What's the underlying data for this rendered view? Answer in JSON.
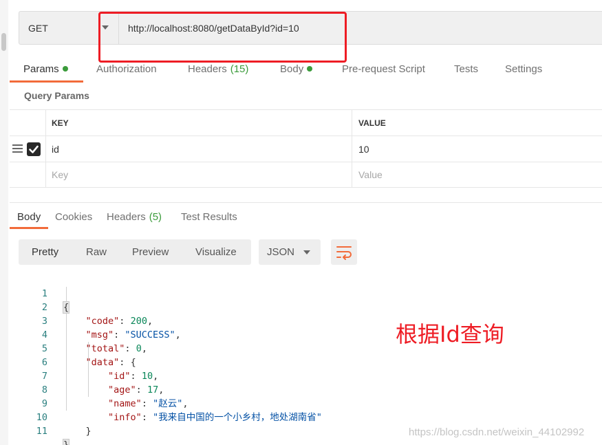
{
  "request": {
    "method": "GET",
    "url": "http://localhost:8080/getDataById?id=10"
  },
  "request_tabs": {
    "params": "Params",
    "authorization": "Authorization",
    "headers": "Headers",
    "headers_count": "(15)",
    "body": "Body",
    "pre_request": "Pre-request Script",
    "tests": "Tests",
    "settings": "Settings"
  },
  "query_params": {
    "title": "Query Params",
    "key_header": "KEY",
    "value_header": "VALUE",
    "rows": [
      {
        "key": "id",
        "value": "10",
        "checked": true
      }
    ],
    "key_placeholder": "Key",
    "value_placeholder": "Value"
  },
  "response_tabs": {
    "body": "Body",
    "cookies": "Cookies",
    "headers": "Headers",
    "headers_count": "(5)",
    "test_results": "Test Results"
  },
  "view_modes": {
    "pretty": "Pretty",
    "raw": "Raw",
    "preview": "Preview",
    "visualize": "Visualize",
    "format": "JSON"
  },
  "response_body": {
    "line_numbers": [
      "1",
      "2",
      "3",
      "4",
      "5",
      "6",
      "7",
      "8",
      "9",
      "10",
      "11"
    ],
    "open_brace": "{",
    "close_brace": "}",
    "code_key": "\"code\"",
    "code_val": "200",
    "msg_key": "\"msg\"",
    "msg_val": "\"SUCCESS\"",
    "total_key": "\"total\"",
    "total_val": "0",
    "data_key": "\"data\"",
    "id_key": "\"id\"",
    "id_val": "10",
    "age_key": "\"age\"",
    "age_val": "17",
    "name_key": "\"name\"",
    "name_val": "\"赵云\"",
    "info_key": "\"info\"",
    "info_val": "\"我来自中国的一个小乡村，地处湖南省\""
  },
  "annotation": "根据Id查询",
  "watermark": "https://blog.csdn.net/weixin_44102992",
  "colors": {
    "accent": "#f26b3a",
    "status_green": "#3b9b3b",
    "annotation_red": "#ee1c24"
  }
}
